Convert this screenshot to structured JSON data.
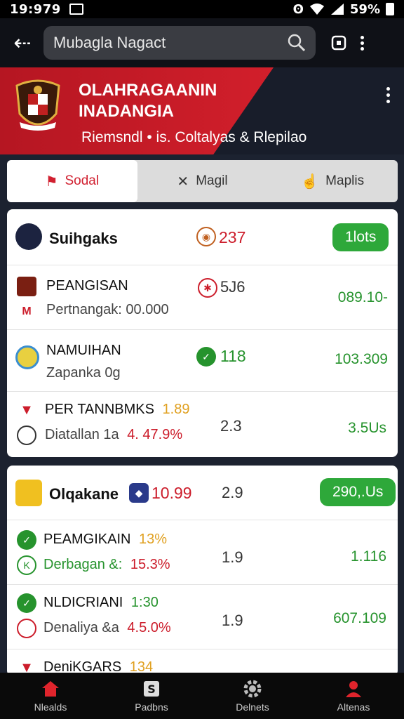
{
  "status_bar": {
    "time": "19:979",
    "battery": "59%"
  },
  "app_bar": {
    "search_value": "Mubagla Nagact"
  },
  "banner": {
    "title_line1": "OLAHRAGAANIN",
    "title_line2": "INADANGIA",
    "subtitle": "Riemsndl • is. Coltalyas & Rlepilao"
  },
  "tabs": [
    {
      "label": "Sodal"
    },
    {
      "label": "Magil"
    },
    {
      "label": "Maplis"
    }
  ],
  "group1": {
    "header": {
      "name": "Suihgaks",
      "value": "237",
      "button": "1lots"
    },
    "rows": [
      {
        "title": "PEANGISAN",
        "subtitle": "Pertnangak: 00.000",
        "value": "5J6",
        "amount": "089.10-"
      },
      {
        "title": "NAMUIHAN",
        "subtitle": "Zapanka 0g",
        "value": "118",
        "amount": "103.309"
      },
      {
        "title": "PER TANNBMKS",
        "title_badge": "1.89",
        "subtitle": "Diatallan 1a",
        "change": "4. 47.9%",
        "value": "2.3",
        "amount": "3.5Us"
      }
    ]
  },
  "group2": {
    "header": {
      "name": "Olqakane",
      "value": "10.99",
      "value2": "2.9",
      "button": "290,.Us"
    },
    "rows": [
      {
        "title": "PEAMGIKAIN",
        "title_badge": "13%",
        "subtitle": "Derbagan &:",
        "change": "15.3%",
        "value": "1.9",
        "amount": "1.116"
      },
      {
        "title": "NLDICRIANI",
        "title_badge": "1:30",
        "subtitle": "Denaliya &a",
        "change": "4.5.0%",
        "value": "1.9",
        "amount": "607.109"
      },
      {
        "title": "DeniKGARS",
        "title_badge": "134"
      }
    ]
  },
  "bottom_nav": [
    {
      "label": "Nlealds"
    },
    {
      "label": "Padbns"
    },
    {
      "label": "Delnets"
    },
    {
      "label": "Altenas"
    }
  ],
  "colors": {
    "accent_red": "#cc1d2b",
    "positive_green": "#26932d",
    "pill_green": "#2ea83a"
  }
}
